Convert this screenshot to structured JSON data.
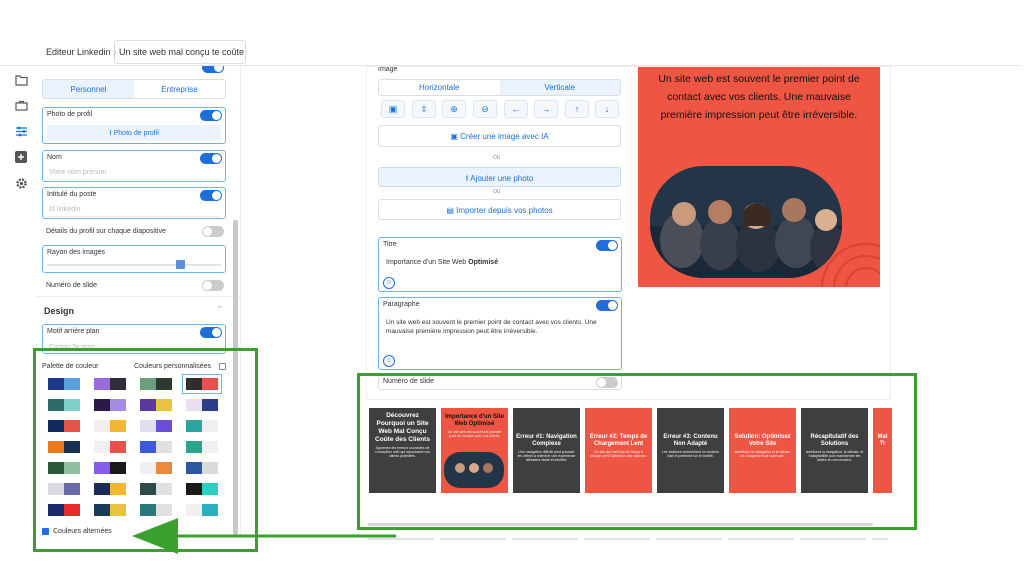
{
  "topbar": {
    "crumb1": "Editeur Linkedin ›",
    "crumb2": "Un site web mal conçu te coûte c"
  },
  "rail": {
    "icons": [
      "menu-icon",
      "folder-icon",
      "briefcase-icon",
      "sliders-icon",
      "plus-square-icon",
      "gear-icon"
    ]
  },
  "colors": {
    "accent": "#1e6fd9",
    "slide_red": "#ef5543",
    "slide_dark": "#3f3f3f",
    "green": "#3aa12f"
  },
  "left": {
    "tabs": [
      "Personnel",
      "Entreprise"
    ],
    "photo": {
      "label": "Photo de profil",
      "button": "⭱ Photo de profil"
    },
    "name": {
      "label": "Nom",
      "placeholder": "Votre nom prénom"
    },
    "job": {
      "label": "Intitulé du poste",
      "placeholder": "Id linkedin"
    },
    "details_label": "Détails du profil sur chaque diapositive",
    "radius_label": "Rayon des images",
    "radius_value": 0.73,
    "slide_number_label": "Numéro de slide",
    "design_label": "Design",
    "motif_label": "Motif arrière plan",
    "motif_value": "Carton 3x gros",
    "palette_label": "Palette de couleur",
    "custom_colors_label": "Couleurs personnalisées",
    "alt_colors_label": "Couleurs alternées"
  },
  "palettes": [
    [
      "#1d3a8a",
      "#5aa0e0"
    ],
    [
      "#9b6bd8",
      "#2e2e3a"
    ],
    [
      "#6b9e7a",
      "#2e3a30"
    ],
    [
      "#2e2e2e",
      "#e8524a"
    ],
    [
      "#2d6a6a",
      "#7fd0c8"
    ],
    [
      "#2a1a4a",
      "#a78be0"
    ],
    [
      "#5b3aa0",
      "#e8c341"
    ],
    [
      "#e8e0f0",
      "#2c3e8a"
    ],
    [
      "#0f2c5c",
      "#e8524a"
    ],
    [
      "#f0f0f0",
      "#f2b631"
    ],
    [
      "#e0e0f0",
      "#6a4ed8"
    ],
    [
      "#2aa5a0",
      "#f0f0f0"
    ],
    [
      "#e87a20",
      "#1a3050"
    ],
    [
      "#f0f0f0",
      "#e8524a"
    ],
    [
      "#3a5ad8",
      "#e0e0e0"
    ],
    [
      "#2aa58a",
      "#f0f0f0"
    ],
    [
      "#2a5a3a",
      "#8fc0a0"
    ],
    [
      "#8a5ae8",
      "#1a1a1a"
    ],
    [
      "#f0f0f0",
      "#e88a40"
    ],
    [
      "#2a5aa0",
      "#dadada"
    ],
    [
      "#d8d8e0",
      "#6a6aa8"
    ],
    [
      "#1a2a5a",
      "#f2b631"
    ],
    [
      "#2e4a4a",
      "#e0e0e0"
    ],
    [
      "#1a1a1a",
      "#2ad0c0"
    ],
    [
      "#1a2a6a",
      "#e82a2a"
    ],
    [
      "#1a3a5a",
      "#e8c341"
    ],
    [
      "#2a7a7a",
      "#e0e0e0"
    ],
    [
      "#f0f0f0",
      "#2ab0c0"
    ]
  ],
  "image": {
    "label": "Image",
    "tabs": [
      "Horizontale",
      "Verticale"
    ],
    "tools": [
      "image-icon",
      "move-vertical-icon",
      "zoom-in-icon",
      "zoom-out-icon",
      "arrow-left-icon",
      "arrow-right-icon",
      "arrow-up-icon",
      "arrow-down-icon"
    ],
    "ai_button": "Créer une image avec IA",
    "or1": "OU",
    "add_photo": "Ajouter une photo",
    "or2": "OU",
    "import": "Importer depuis vos photos"
  },
  "title_card": {
    "label": "Titre",
    "text_normal": "Importance d'un Site Web ",
    "text_bold": "Optimisé"
  },
  "para_card": {
    "label": "Paragraphe",
    "text": "Un site web est souvent le premier point de contact avec vos clients. Une mauvaise première impression peut être irréversible."
  },
  "slide_number_label": "Numéro de slide",
  "preview": {
    "text": "Un site web est souvent le premier point de contact avec vos clients. Une mauvaise première impression peut être irréversible."
  },
  "slides": [
    {
      "title": "Découvrez Pourquoi un Site Web Mal Conçu Coûte des Clients",
      "bg": "#3f3f3f",
      "body": "Apprenez les erreurs courantes de conception web qui repoussent vos clients potentiels."
    },
    {
      "title": "Importance d'un Site Web Optimisé",
      "bg": "#ef5543",
      "body": "Un site web est souvent le premier point de contact avec vos clients."
    },
    {
      "title": "Erreur #1: Navigation Complexe",
      "bg": "#3f3f3f",
      "body": "Une navigation difficile peut pousser les clients à chercher une expérience utilisateur facile et intuitive."
    },
    {
      "title": "Erreur #2: Temps de Chargement Lent",
      "bg": "#ef5543",
      "body": "Un site qui met trop de temps à charger perd l'attention des visiteurs."
    },
    {
      "title": "Erreur #3: Contenu Non Adapté",
      "bg": "#3f3f3f",
      "body": "Les visiteurs recherchent un contenu clair et pertinent sur le mobile."
    },
    {
      "title": "Solution: Optimisez Votre Site",
      "bg": "#ef5543",
      "body": "Améliorez la navigation et la vitesse de chargement de votre site."
    },
    {
      "title": "Récapitulatif des Solutions",
      "bg": "#3f3f3f",
      "body": "Améliorez la navigation, la vitesse, et l'adaptabilité pour transformer les visites en conversions."
    },
    {
      "title": "Mal Tr",
      "bg": "#ef5543",
      "body": ""
    }
  ]
}
